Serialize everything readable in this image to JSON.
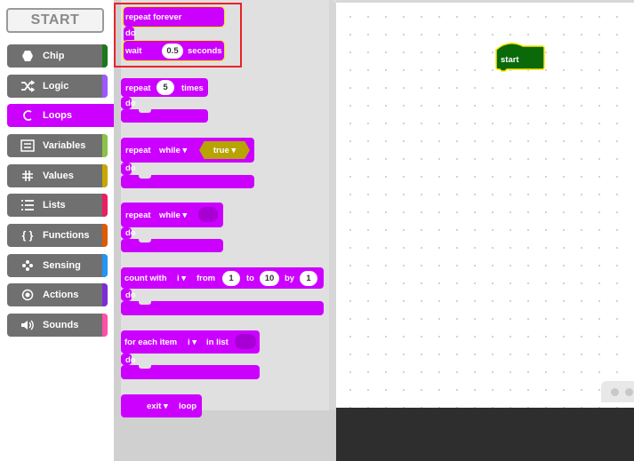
{
  "start_button": "START",
  "categories": [
    {
      "name": "chip",
      "label": "Chip",
      "icon": "hexagon-icon",
      "color": "#1a7a1a"
    },
    {
      "name": "logic",
      "label": "Logic",
      "icon": "shuffle-icon",
      "color": "#9b59ff"
    },
    {
      "name": "loops",
      "label": "Loops",
      "icon": "loop-arrow-icon",
      "color": "#cc00ff",
      "active": true
    },
    {
      "name": "variables",
      "label": "Variables",
      "icon": "variables-box-icon",
      "color": "#8bc34a"
    },
    {
      "name": "values",
      "label": "Values",
      "icon": "hash-icon",
      "color": "#c6a800"
    },
    {
      "name": "lists",
      "label": "Lists",
      "icon": "list-icon",
      "color": "#e91e63"
    },
    {
      "name": "functions",
      "label": "Functions",
      "icon": "braces-icon",
      "color": "#e05a00"
    },
    {
      "name": "sensing",
      "label": "Sensing",
      "icon": "sensing-dots-icon",
      "color": "#2196f3"
    },
    {
      "name": "actions",
      "label": "Actions",
      "icon": "target-icon",
      "color": "#7b2dd6"
    },
    {
      "name": "sounds",
      "label": "Sounds",
      "icon": "speaker-icon",
      "color": "#ff4fa8"
    }
  ],
  "blocks": {
    "repeat_forever": {
      "title": "repeat forever",
      "do": "do",
      "wait": "wait",
      "wait_value": "0.5",
      "seconds": "seconds"
    },
    "repeat_times": {
      "repeat": "repeat",
      "count": "5",
      "times": "times",
      "do": "do"
    },
    "repeat_while_true": {
      "repeat": "repeat",
      "mode": "while",
      "bool": "true",
      "do": "do"
    },
    "repeat_while": {
      "repeat": "repeat",
      "mode": "while",
      "do": "do"
    },
    "count_with": {
      "label": "count with",
      "var": "i",
      "from": "from",
      "from_value": "1",
      "to": "to",
      "to_value": "10",
      "by": "by",
      "by_value": "1",
      "do": "do"
    },
    "for_each": {
      "label": "for each item",
      "var": "i",
      "in_list": "in list",
      "do": "do"
    },
    "exit_loop": {
      "mode": "exit",
      "loop": "loop"
    }
  },
  "canvas": {
    "start_block": "start",
    "start_color": "#0a6a0a"
  },
  "colors": {
    "loops": "#cc00ff",
    "highlight": "#e8232a"
  }
}
